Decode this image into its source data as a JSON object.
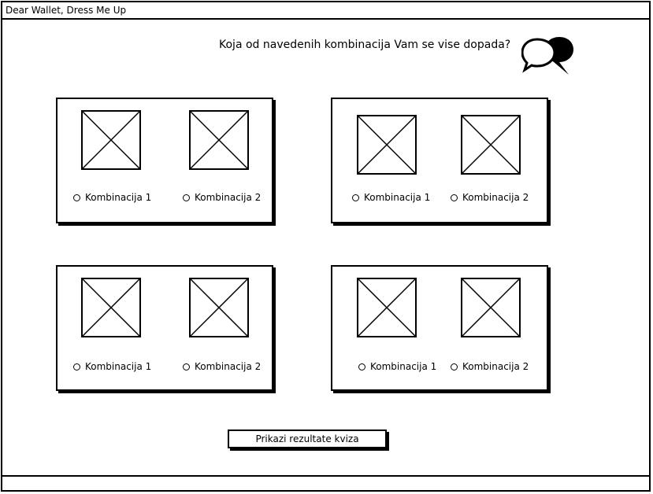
{
  "window": {
    "title": "Dear Wallet, Dress Me Up"
  },
  "question": "Koja od navedenih kombinacija Vam se vise dopada?",
  "icons": {
    "chat": "chat-bubbles-icon",
    "image_placeholder": "image-placeholder-icon",
    "radio": "radio-unchecked"
  },
  "panels": [
    {
      "option1": "Kombinacija 1",
      "option2": "Kombinacija 2"
    },
    {
      "option1": "Kombinacija 1",
      "option2": "Kombinacija 2"
    },
    {
      "option1": "Kombinacija 1",
      "option2": "Kombinacija 2"
    },
    {
      "option1": "Kombinacija 1",
      "option2": "Kombinacija 2"
    }
  ],
  "submit_label": "Prikazi rezultate kviza"
}
